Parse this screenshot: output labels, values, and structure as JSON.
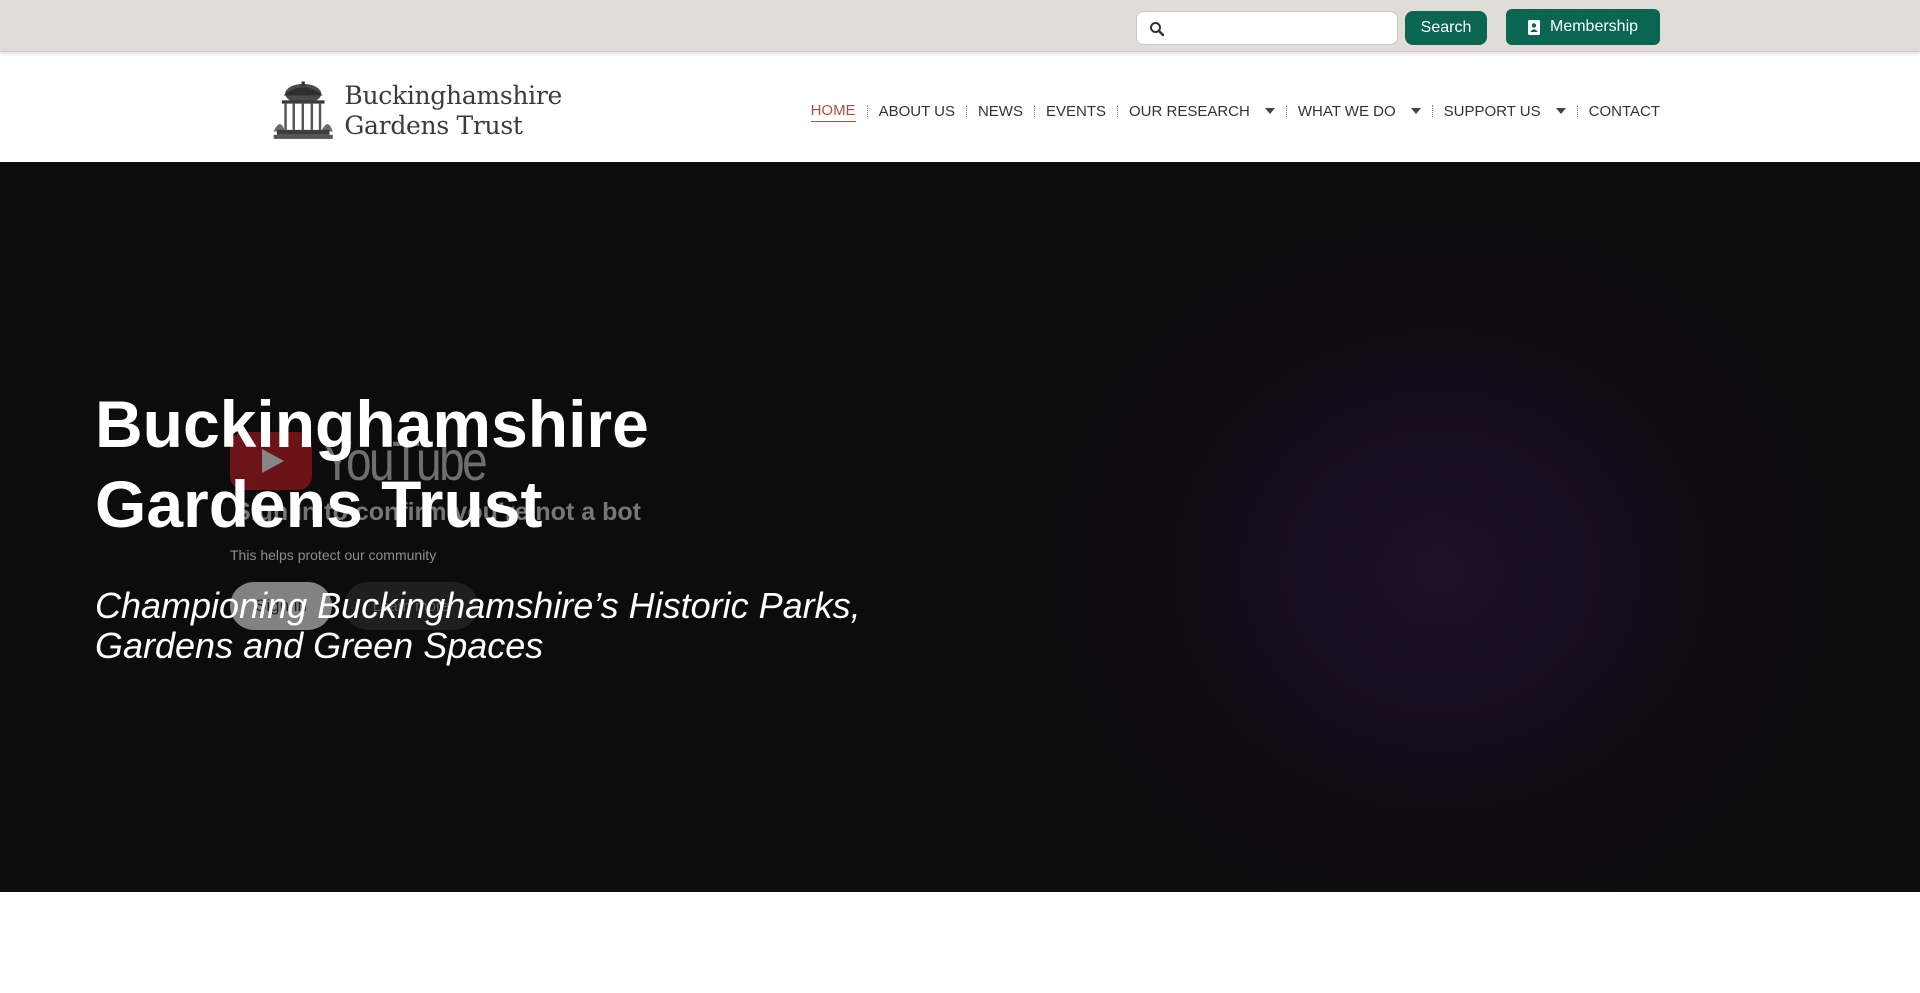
{
  "topbar": {
    "search": {
      "placeholder": "",
      "value": "",
      "icon": "search-icon"
    },
    "search_button_label": "Search",
    "membership_label": "Membership",
    "membership_icon": "id-card-icon",
    "accent_color": "#0a6650"
  },
  "header": {
    "logo": {
      "line1": "Buckinghamshire",
      "line2": "Gardens Trust"
    },
    "nav": [
      {
        "label": "HOME",
        "active": true
      },
      {
        "label": "ABOUT US"
      },
      {
        "label": "NEWS"
      },
      {
        "label": "EVENTS"
      },
      {
        "label": "OUR RESEARCH",
        "dropdown": true
      },
      {
        "label": "WHAT WE DO",
        "dropdown": true
      },
      {
        "label": "SUPPORT US",
        "dropdown": true
      },
      {
        "label": "CONTACT"
      }
    ],
    "active_color": "#a85048"
  },
  "hero": {
    "title_line1": "Buckinghamshire",
    "title_line2": "Gardens Trust",
    "subtitle_line1": "Championing Buckinghamshire’s Historic Parks,",
    "subtitle_line2": "Gardens and Green Spaces",
    "video": {
      "brand": "YouTube",
      "message": "Sign in to confirm you’re not a bot",
      "sub": "This helps protect our community",
      "signin_label": "Sign in",
      "learn_more_label": "Learn more"
    }
  }
}
